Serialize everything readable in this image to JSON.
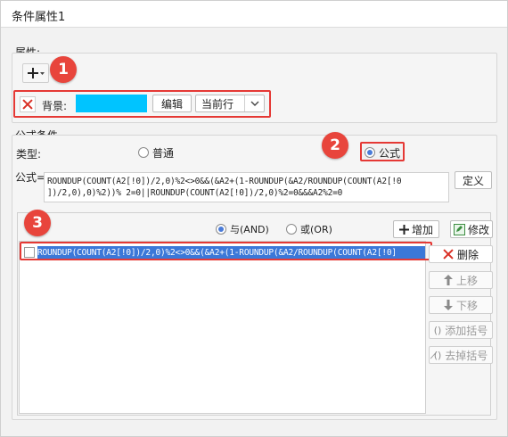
{
  "window": {
    "title": "条件属性1"
  },
  "attributes": {
    "group_label": "属性:",
    "add_icon": "plus-icon",
    "dropdown_icon": "chevron-down-icon",
    "row": {
      "delete_icon": "close-icon",
      "label": "背景:",
      "color_swatch": "#00c4ff",
      "edit_button": "编辑",
      "scope_value": "当前行"
    }
  },
  "formula_condition": {
    "group_label": "公式条件",
    "type_label": "类型:",
    "options": [
      {
        "label": "普通",
        "selected": false
      },
      {
        "label": "公式",
        "selected": true
      }
    ],
    "formula_label": "公式=",
    "formula_line1": "ROUNDUP(COUNT(A2[!0])/2,0)%2<>0&&(&A2+(1-ROUNDUP(&A2/ROUNDUP(COUNT(A2[!0",
    "formula_line2": "])/2,0),0)%2))% 2=0||ROUNDUP(COUNT(A2[!0])/2,0)%2=0&&&A2%2=0",
    "define_button": "定义"
  },
  "condition_list": {
    "and_label": "与(AND)",
    "or_label": "或(OR)",
    "add_button": "增加",
    "modify_button": "修改",
    "items": [
      "ROUNDUP(COUNT(A2[!0])/2,0)%2<>0&&(&A2+(1-ROUNDUP(&A2/ROUNDUP(COUNT(A2[!0]"
    ],
    "side_buttons": {
      "delete": "删除",
      "move_up": "上移",
      "move_down": "下移",
      "add_paren": "添加括号",
      "remove_paren": "去掉括号"
    }
  },
  "callouts": [
    "1",
    "2",
    "3"
  ],
  "colors": {
    "callout": "#e8453c",
    "highlight_border": "#e53935",
    "selection": "#3b78d8"
  }
}
